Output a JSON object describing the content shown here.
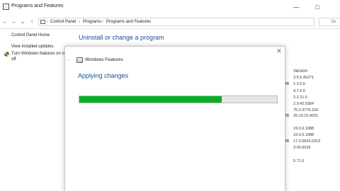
{
  "window": {
    "title": "Programs and Features",
    "minimize_glyph": "—",
    "maximize_glyph": "□"
  },
  "nav": {
    "back_icon": "←",
    "forward_icon": "→",
    "dropdown_icon": "⌄",
    "up_icon": "↑",
    "breadcrumb": [
      "Control Panel",
      "Programs",
      "Programs and Features"
    ],
    "separator": "›",
    "search_placeholder": "Se"
  },
  "sidebar": {
    "items": [
      {
        "label": "Control Panel Home"
      },
      {
        "label": "View installed updates"
      },
      {
        "label": "Turn Windows features on or"
      },
      {
        "label": "off"
      }
    ]
  },
  "main": {
    "title": "Uninstall or change a program",
    "version_header": "Version",
    "versions": [
      "3.5.5.45271",
      "1.3.5.6",
      "4.7.0.0",
      "2.2.21.0",
      "2.3.42.5304",
      "75.0.3770.100",
      "20.19.15.4531",
      "19.0.0.1088",
      "19.0.0.1088",
      "17.3.6816.0313",
      "3.00.0029",
      "5.71.0"
    ],
    "size_unit": "MB"
  },
  "dialog": {
    "title": "Windows Features",
    "close_glyph": "✕",
    "back_glyph": "←",
    "status": "Applying changes",
    "progress": 0.72
  },
  "colors": {
    "accent": "#1a4f8f",
    "progress_green": "#06b025"
  }
}
